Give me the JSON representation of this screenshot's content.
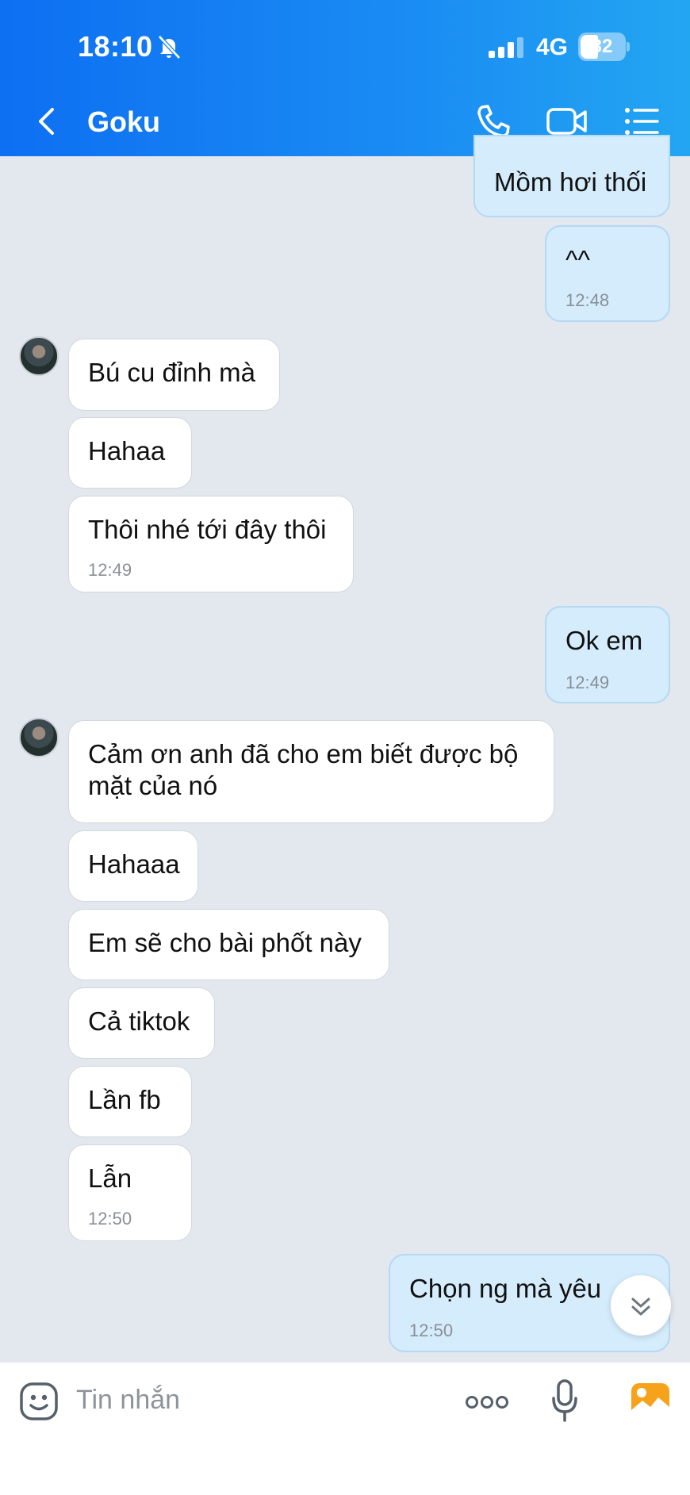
{
  "status_bar": {
    "time": "18:10",
    "network": "4G",
    "battery": "32"
  },
  "header": {
    "contact_name": "Goku"
  },
  "messages": [
    {
      "text": "Mồm hơi thối"
    },
    {
      "text": "^^",
      "time": "12:48"
    },
    {
      "text": "Bú cu đỉnh mà"
    },
    {
      "text": "Hahaa"
    },
    {
      "text": "Thôi nhé tới đây thôi",
      "time": "12:49"
    },
    {
      "text": "Ok em",
      "time": "12:49"
    },
    {
      "text": "Cảm ơn anh đã cho em biết được bộ mặt của nó"
    },
    {
      "text": "Hahaaa"
    },
    {
      "text": "Em sẽ cho bài phốt này"
    },
    {
      "text": "Cả tiktok"
    },
    {
      "text": "Lần fb"
    },
    {
      "text": "Lẫn",
      "time": "12:50"
    },
    {
      "text": "Chọn ng mà yêu",
      "time": "12:50"
    }
  ],
  "composer": {
    "placeholder": "Tin nhắn"
  },
  "colors": {
    "header_start": "#0d6ff2",
    "header_end": "#23a6f2",
    "outgoing_bubble": "#d4ecfc",
    "incoming_bubble": "#ffffff",
    "background": "#e3e7ee"
  },
  "icons": [
    "bell-off-icon",
    "signal-icon",
    "battery-icon",
    "back-chevron-icon",
    "phone-icon",
    "video-call-icon",
    "menu-list-icon",
    "scroll-down-icon",
    "sticker-emoji-icon",
    "more-dots-icon",
    "microphone-icon",
    "gallery-image-icon"
  ]
}
